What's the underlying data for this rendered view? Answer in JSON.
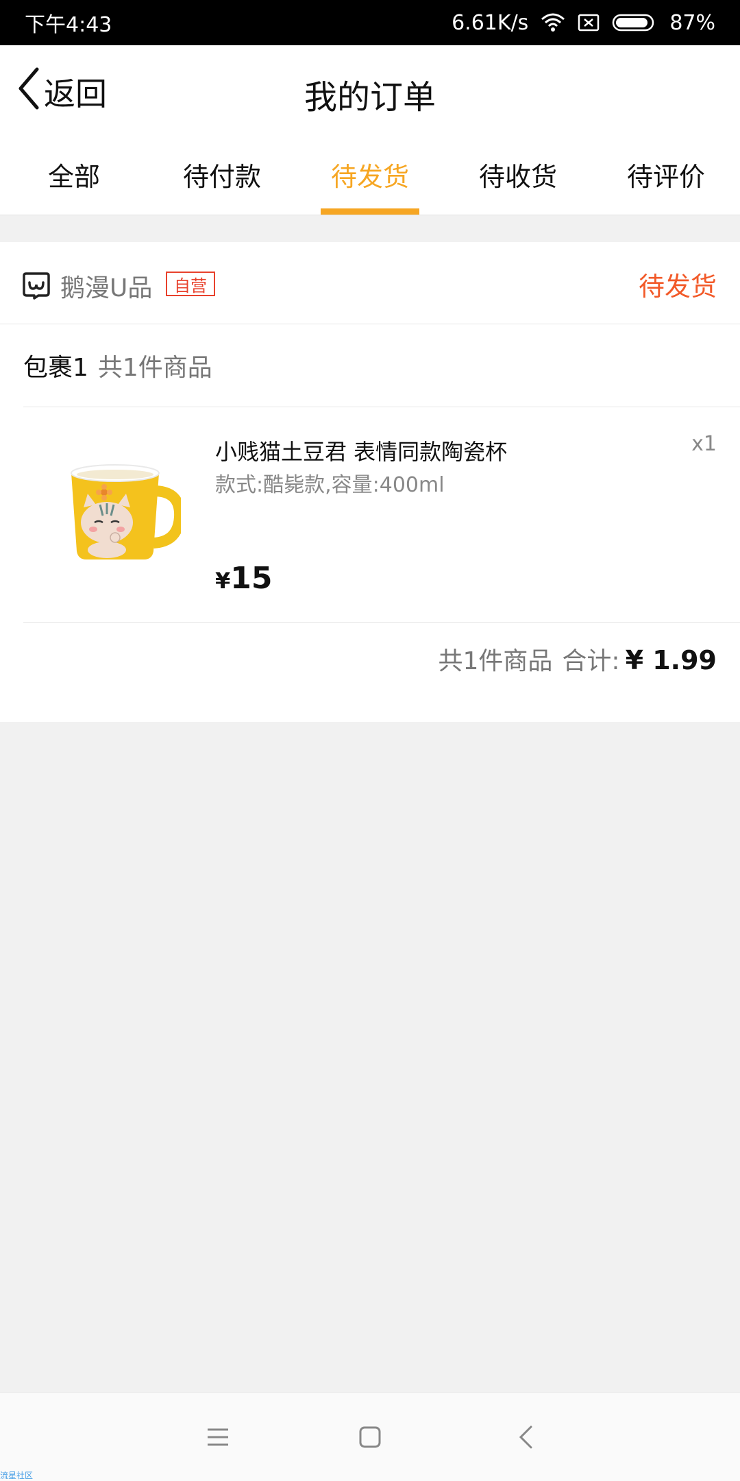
{
  "status_bar": {
    "time": "下午4:43",
    "network_speed": "6.61K/s",
    "battery": "87%"
  },
  "navbar": {
    "back_label": "返回",
    "title": "我的订单"
  },
  "tabs": [
    {
      "label": "全部",
      "active": false
    },
    {
      "label": "待付款",
      "active": false
    },
    {
      "label": "待发货",
      "active": true
    },
    {
      "label": "待收货",
      "active": false
    },
    {
      "label": "待评价",
      "active": false
    }
  ],
  "order": {
    "shop_name": "鹅漫U品",
    "self_badge": "自营",
    "status": "待发货",
    "package_label": "包裹1",
    "package_count": "共1件商品",
    "item": {
      "name": "小贱猫土豆君 表情同款陶瓷杯",
      "spec": "款式:酷毙款,容量:400ml",
      "qty": "x1",
      "currency": "¥",
      "price": "15"
    },
    "summary": {
      "count_text": "共1件商品",
      "total_label": "合计:",
      "total_amount": "¥ 1.99"
    }
  },
  "watermark": "流星社区",
  "colors": {
    "accent": "#f6a623",
    "status_red": "#f25a29",
    "badge_red": "#e8412c"
  }
}
